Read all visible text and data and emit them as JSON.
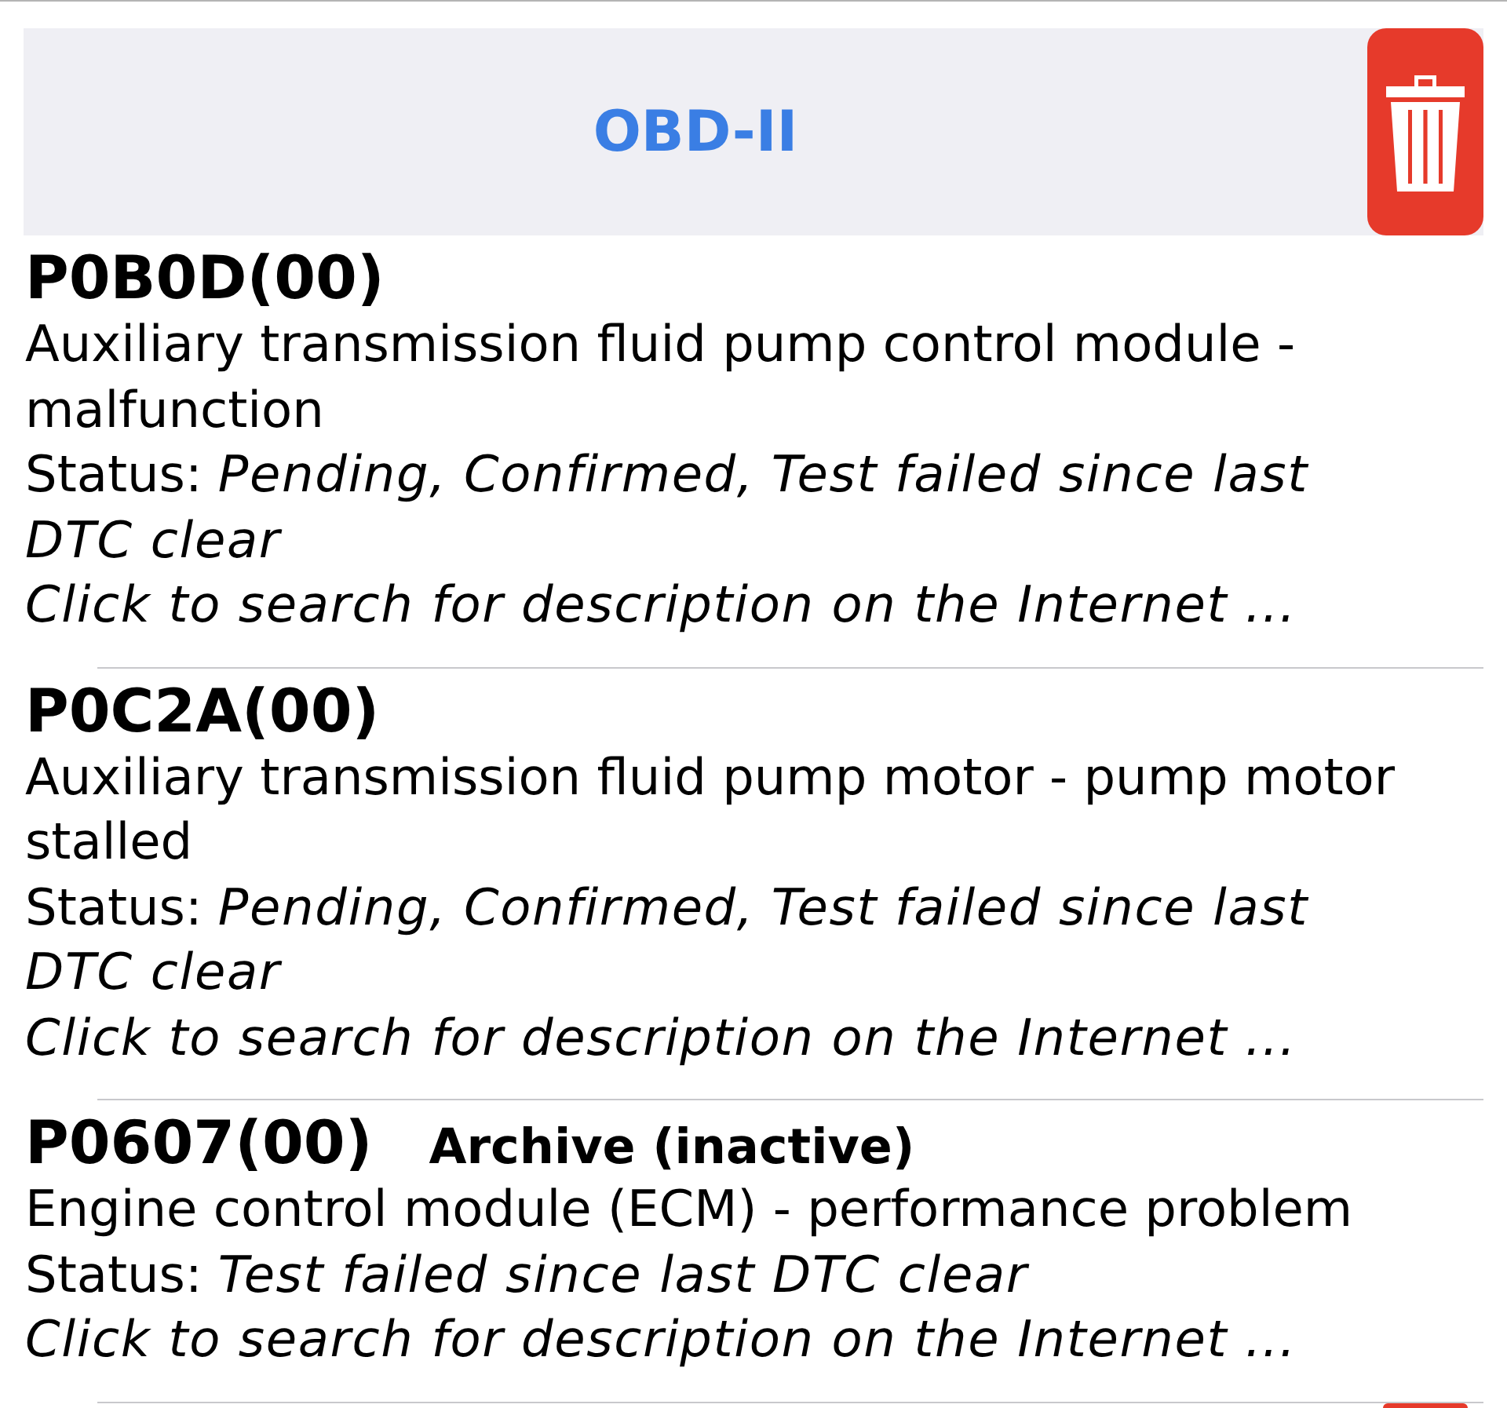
{
  "header": {
    "title": "OBD-II"
  },
  "codes": [
    {
      "code": "P0B0D(00)",
      "description": "Auxiliary transmission fluid pump control module - malfunction",
      "status": "Status: *Pending, Confirmed, Test failed since last DTC clear*",
      "link": "Click to search for description on the Internet ..."
    },
    {
      "code": "P0C2A(00)",
      "description": "Auxiliary transmission fluid pump motor - pump motor stalled",
      "status": "Status: *Pending, Confirmed, Test failed since last DTC clear*",
      "link": "Click to search for description on the Internet ..."
    },
    {
      "code": "P0607(00)",
      "tag": "Archive (inactive)",
      "description": "Engine control module (ECM) - performance problem",
      "status": "Status: *Test failed since last DTC clear*",
      "link": "Click to search for description on the Internet ..."
    }
  ]
}
